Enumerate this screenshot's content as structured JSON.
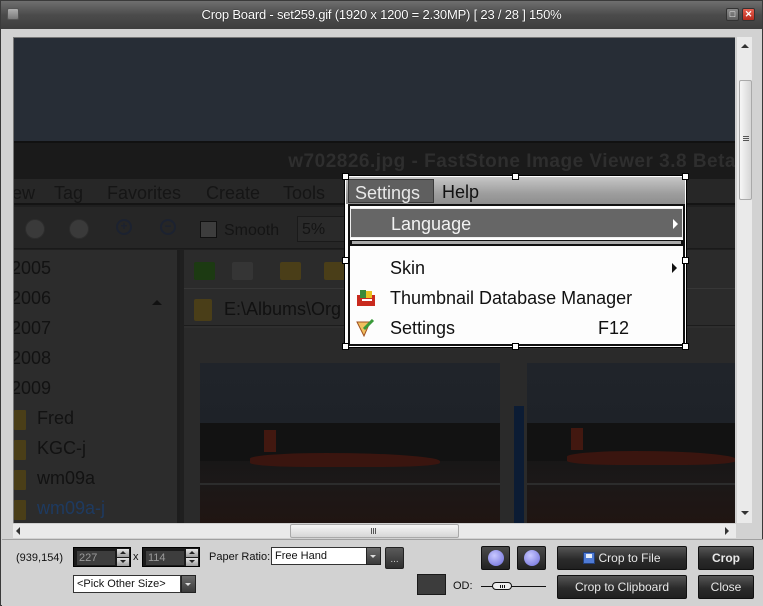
{
  "window": {
    "title": "Crop Board  -  set259.gif  (1920 x 1200 = 2.30MP)  [ 23 / 28 ]   150%",
    "maximize_glyph": "□",
    "close_glyph": "✕"
  },
  "screenshot_content": {
    "window_title": "w702826.jpg  -  FastStone Image Viewer 3.8 Beta",
    "menubar": [
      "ew",
      "Tag",
      "Favorites",
      "Create",
      "Tools",
      "Settings",
      "Help"
    ],
    "toolbar": {
      "smooth_label": "Smooth",
      "zoom_value": "5%",
      "zoom_in_glyph": "+",
      "zoom_out_glyph": "−"
    },
    "folder_tree": [
      "2005",
      "2006",
      "2007",
      "2008",
      "2009",
      "Fred",
      "KGC-j",
      "wm09a",
      "wm09a-j"
    ],
    "path": "E:\\Albums\\Org",
    "settings_menu": {
      "items": [
        {
          "label": "Language",
          "submenu": true,
          "highlighted": true
        },
        {
          "label": "Skin",
          "submenu": true
        },
        {
          "label": "Thumbnail Database Manager",
          "icon": "database-icon"
        },
        {
          "label": "Settings",
          "shortcut": "F12",
          "icon": "settings-icon"
        }
      ]
    }
  },
  "panel": {
    "cursor_coords": "(939,154)",
    "width_value": "227",
    "height_value": "114",
    "times_sign": "x",
    "paper_ratio_label": "Paper Ratio:",
    "paper_ratio_value": "Free Hand",
    "ellipsis_label": "...",
    "pick_size_value": "<Pick Other Size>",
    "prev_glyph": "|◀",
    "next_glyph": "▶|",
    "crop_to_file": "Crop to File",
    "crop_to_clipboard": "Crop to Clipboard",
    "crop": "Crop",
    "close": "Close",
    "od_label": "OD:",
    "od_slider_fraction": 0.25
  },
  "colors": {
    "titlebar": "#4b4b4b",
    "panel_bg": "#d2d2d2",
    "dark_button": "#2b2b2b",
    "close_button": "#c8352a"
  }
}
